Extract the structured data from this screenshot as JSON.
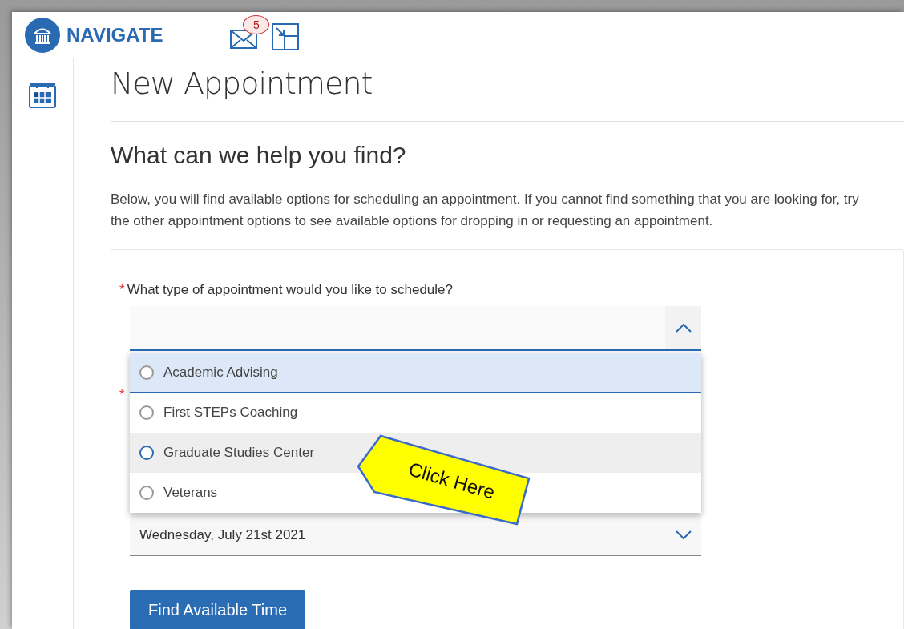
{
  "header": {
    "logo_text": "NAVIGATE",
    "mail_count": "5"
  },
  "page": {
    "title": "New Appointment",
    "heading": "What can we help you find?",
    "intro": "Below, you will find available options for scheduling an appointment. If you cannot find something that you are looking for, try the other appointment options to see available options for dropping in or requesting an appointment."
  },
  "form": {
    "type_question": {
      "label": "What type of appointment would you like to schedule?",
      "required": true,
      "required_mark": "*",
      "expanded": true,
      "options": [
        {
          "label": "Academic Advising",
          "selected": false,
          "highlighted": true,
          "hovered": false
        },
        {
          "label": "First STEPs Coaching",
          "selected": false,
          "highlighted": false,
          "hovered": false
        },
        {
          "label": "Graduate Studies Center",
          "selected": false,
          "highlighted": false,
          "hovered": true
        },
        {
          "label": "Veterans",
          "selected": false,
          "highlighted": false,
          "hovered": false
        }
      ]
    },
    "date_field": {
      "required": true,
      "required_mark": "*",
      "value": "Wednesday, July 21st 2021"
    },
    "submit": "Find Available Time"
  },
  "callout": {
    "text": "Click Here"
  }
}
